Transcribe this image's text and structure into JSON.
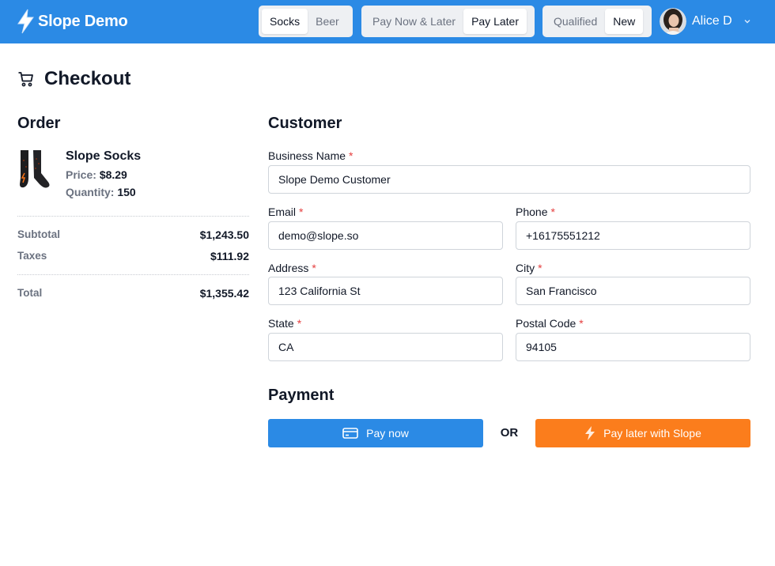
{
  "header": {
    "brand": "Slope Demo",
    "product_toggle": [
      "Socks",
      "Beer"
    ],
    "product_active": "Socks",
    "pay_toggle": [
      "Pay Now & Later",
      "Pay Later"
    ],
    "pay_active": "Pay Later",
    "customer_toggle": [
      "Qualified",
      "New"
    ],
    "customer_active": "New",
    "user_name": "Alice D"
  },
  "page": {
    "title": "Checkout"
  },
  "order": {
    "heading": "Order",
    "product": {
      "name": "Slope Socks",
      "price_label": "Price:",
      "price": "$8.29",
      "quantity_label": "Quantity:",
      "quantity": "150"
    },
    "subtotal_label": "Subtotal",
    "subtotal": "$1,243.50",
    "taxes_label": "Taxes",
    "taxes": "$111.92",
    "total_label": "Total",
    "total": "$1,355.42"
  },
  "customer": {
    "heading": "Customer",
    "required_mark": "*",
    "business_name": {
      "label": "Business Name",
      "value": "Slope Demo Customer"
    },
    "email": {
      "label": "Email",
      "value": "demo@slope.so"
    },
    "phone": {
      "label": "Phone",
      "value": "+16175551212"
    },
    "address": {
      "label": "Address",
      "value": "123 California St"
    },
    "city": {
      "label": "City",
      "value": "San Francisco"
    },
    "state": {
      "label": "State",
      "value": "CA"
    },
    "postal_code": {
      "label": "Postal Code",
      "value": "94105"
    }
  },
  "payment": {
    "heading": "Payment",
    "pay_now": "Pay now",
    "or": "OR",
    "pay_later": "Pay later with Slope"
  },
  "colors": {
    "primary": "#2b8ae5",
    "orange": "#fb7d1c",
    "required": "#e53e3e"
  },
  "icons": [
    "lightning-icon",
    "cart-icon",
    "card-icon",
    "chevron-down-icon"
  ]
}
